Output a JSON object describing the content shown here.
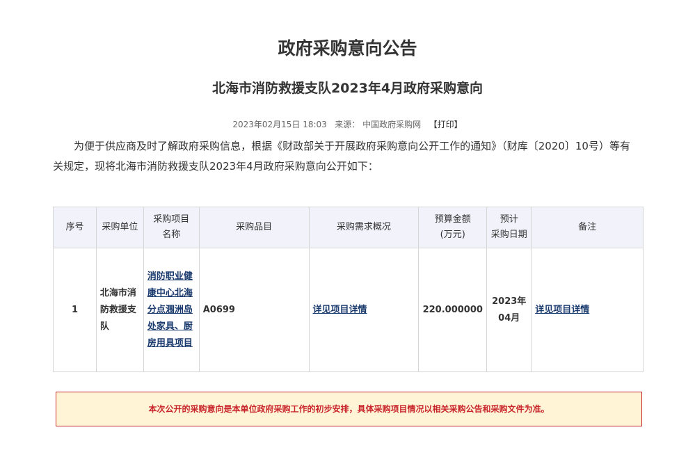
{
  "header": {
    "title": "政府采购意向公告",
    "subtitle": "北海市消防救援支队2023年4月政府采购意向"
  },
  "meta": {
    "datetime": "2023年02月15日 18:03",
    "source_label": "来源：",
    "source": "中国政府采购网",
    "print": "【打印】"
  },
  "intro": "为便于供应商及时了解政府采购信息，根据《财政部关于开展政府采购意向公开工作的通知》（财库〔2020〕10号）等有关规定，现将北海市消防救援支队2023年4月政府采购意向公开如下：",
  "table": {
    "headers": {
      "seq": "序号",
      "unit": "采购单位",
      "project_l1": "采购项目",
      "project_l2": "名称",
      "category": "采购品目",
      "demand": "采购需求概况",
      "budget_l1": "预算金额",
      "budget_l2": "(万元)",
      "date_l1": "预计",
      "date_l2": "采购日期",
      "remark": "备注"
    },
    "rows": [
      {
        "seq": "1",
        "unit": "北海市消防救援支队",
        "project": "消防职业健康中心北海分点涠洲岛处家具、厨房用具项目",
        "category": "A0699",
        "demand": "详见项目详情",
        "budget": "220.000000",
        "date": "2023年04月",
        "remark": "详见项目详情"
      }
    ]
  },
  "notice": "本次公开的采购意向是本单位政府采购工作的初步安排，具体采购项目情况以相关采购公告和采购文件为准。"
}
